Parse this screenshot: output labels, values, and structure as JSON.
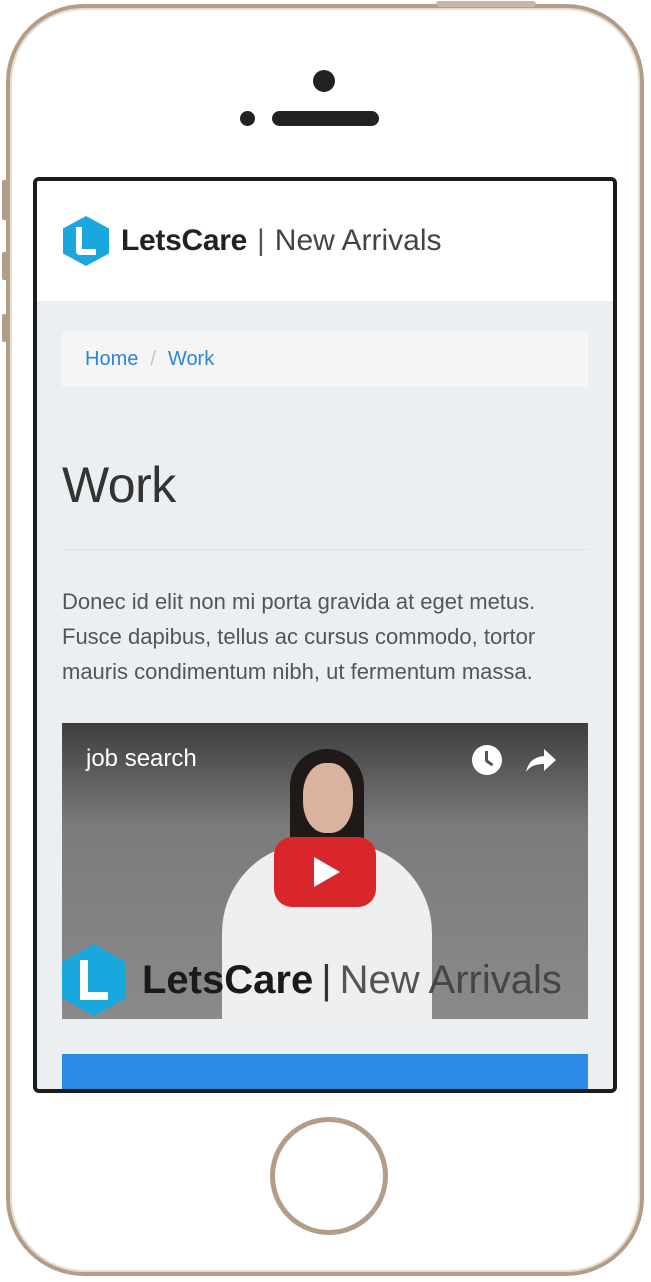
{
  "brand": {
    "name": "LetsCare",
    "separator": "|",
    "subtitle": "New Arrivals",
    "accent": "#1aa7dd"
  },
  "breadcrumb": {
    "items": [
      "Home",
      "Work"
    ],
    "separator": "/"
  },
  "page": {
    "title": "Work",
    "lead": "Donec id elit non mi porta gravida at eget metus. Fusce dapibus, tellus ac cursus commodo, tortor mauris condimentum nibh, ut fermentum massa."
  },
  "video": {
    "title": "job search",
    "watermark": {
      "name": "LetsCare",
      "separator": "|",
      "subtitle": "New Arrivals"
    },
    "icons": [
      "watch-later-icon",
      "share-icon",
      "play-icon"
    ]
  },
  "colors": {
    "link": "#2a86d8",
    "play": "#d8262b",
    "cta": "#2d8be6",
    "frame": "#b39d88"
  }
}
